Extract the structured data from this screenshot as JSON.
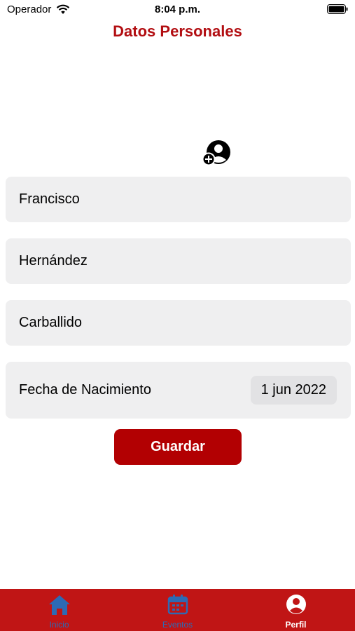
{
  "status_bar": {
    "carrier": "Operador",
    "time": "8:04 p.m."
  },
  "header": {
    "title": "Datos Personales"
  },
  "form": {
    "first_name": "Francisco",
    "last_name": "Hernández",
    "second_last_name": "Carballido",
    "birth_date_label": "Fecha de Nacimiento",
    "birth_date_value": "1 jun 2022",
    "save_label": "Guardar"
  },
  "tabs": [
    {
      "label": "Inicio",
      "icon": "home-icon",
      "active": false
    },
    {
      "label": "Eventos",
      "icon": "calendar-icon",
      "active": false
    },
    {
      "label": "Perfil",
      "icon": "profile-icon",
      "active": true
    }
  ],
  "colors": {
    "accent": "#b20e12",
    "tab_bar": "#c01515",
    "inactive_tab": "#2d6ab4",
    "field_bg": "#efeff0"
  }
}
